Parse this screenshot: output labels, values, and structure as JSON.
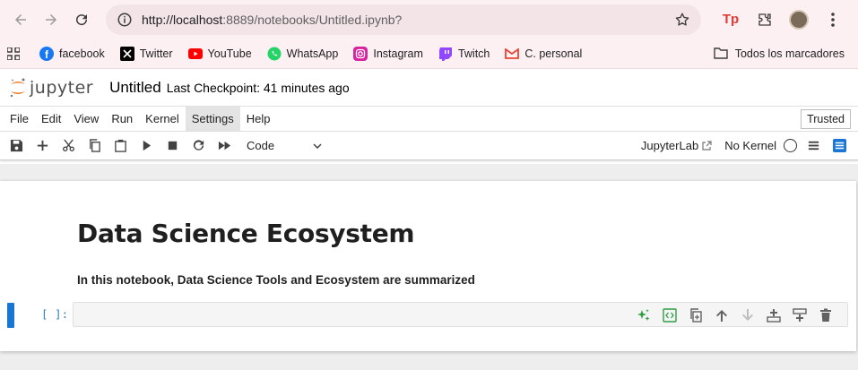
{
  "browser": {
    "url_scheme_host": "http://localhost",
    "url_rest": ":8889/notebooks/Untitled.ipynb?",
    "bookmarks": [
      {
        "label": "facebook",
        "icon": "facebook-icon",
        "color": "#1877f2"
      },
      {
        "label": "Twitter",
        "icon": "x-twitter-icon",
        "color": "#000000"
      },
      {
        "label": "YouTube",
        "icon": "youtube-icon",
        "color": "#ff0000"
      },
      {
        "label": "WhatsApp",
        "icon": "whatsapp-icon",
        "color": "#25d366"
      },
      {
        "label": "Instagram",
        "icon": "instagram-icon",
        "color": "#d6249f"
      },
      {
        "label": "Twitch",
        "icon": "twitch-icon",
        "color": "#9146ff"
      },
      {
        "label": "C. personal",
        "icon": "gmail-icon",
        "color": "#ea4335"
      }
    ],
    "all_bookmarks": "Todos los marcadores",
    "extension_label": "Tp"
  },
  "jupyter": {
    "logo_text": "jupyter",
    "notebook_title": "Untitled",
    "checkpoint": "Last Checkpoint: 41 minutes ago",
    "menu": [
      "File",
      "Edit",
      "View",
      "Run",
      "Kernel",
      "Settings",
      "Help"
    ],
    "active_menu": "Settings",
    "trusted": "Trusted",
    "cell_type": "Code",
    "jupyterlab_link": "JupyterLab",
    "kernel_status": "No Kernel",
    "accent_color": "#1976d2",
    "logo_color": "#f37726"
  },
  "notebook": {
    "heading": "Data Science Ecosystem",
    "paragraph": "In this notebook, Data Science Tools and Ecosystem are summarized",
    "code_prompt": "[ ]:"
  }
}
